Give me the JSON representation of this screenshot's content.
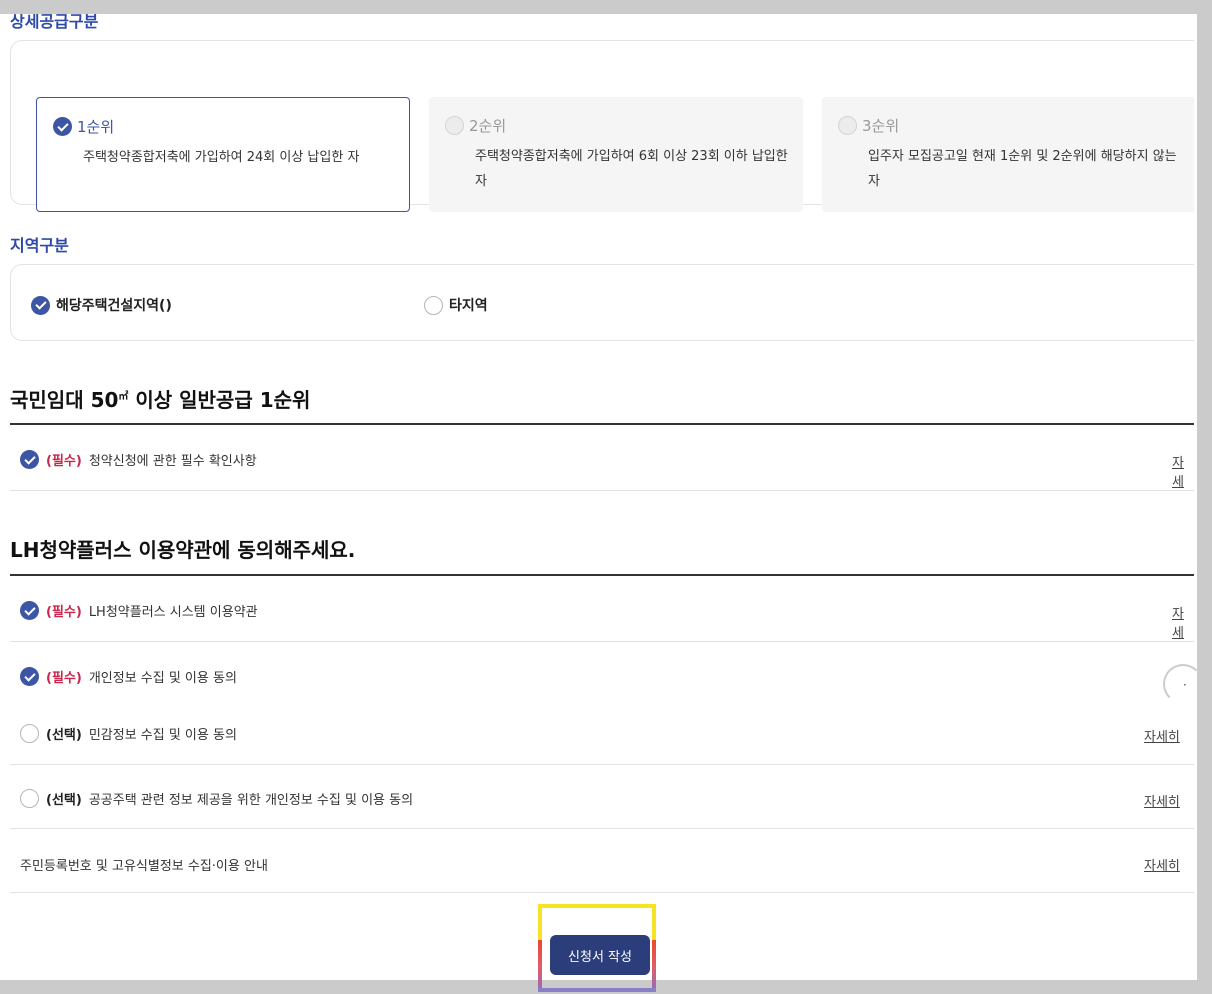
{
  "supply": {
    "heading": "상세공급구분",
    "options": [
      {
        "label": "1순위",
        "desc": "주택청약종합저축에 가입하여 24회 이상 납입한 자",
        "selected": true
      },
      {
        "label": "2순위",
        "desc": "주택청약종합저축에 가입하여 6회 이상 23회 이하 납입한 자",
        "selected": false
      },
      {
        "label": "3순위",
        "desc": "입주자 모집공고일 현재 1순위 및 2순위에 해당하지 않는 자",
        "selected": false
      }
    ]
  },
  "region": {
    "heading": "지역구분",
    "options": [
      {
        "label": "해당주택건설지역()",
        "selected": true
      },
      {
        "label": "타지역",
        "selected": false
      }
    ]
  },
  "rank_section": {
    "title_prefix": "국민임대 50",
    "title_unit": "㎡",
    "title_suffix": " 이상 일반공급 1순위",
    "items": [
      {
        "tag": "(필수)",
        "text": "청약신청에 관한 필수 확인사항",
        "link": "자세"
      }
    ]
  },
  "terms_section": {
    "title": "LH청약플러스 이용약관에 동의해주세요.",
    "items": [
      {
        "tag": "(필수)",
        "text": "LH청약플러스 시스템 이용약관",
        "link": "자세"
      },
      {
        "tag": "(필수)",
        "text": "개인정보 수집 및 이용 동의",
        "link": ""
      },
      {
        "tag": "(선택)",
        "text": "민감정보 수집 및 이용 동의",
        "link": "자세히"
      },
      {
        "tag": "(선택)",
        "text": "공공주택 관련 정보 제공을 위한 개인정보 수집 및 이용 동의",
        "link": "자세히"
      }
    ],
    "notice": {
      "text": "주민등록번호 및 고유식별정보 수집·이용 안내",
      "link": "자세히"
    }
  },
  "cta": {
    "label": "신청서 작성"
  },
  "spinner": {
    "mark": "·"
  },
  "colors": {
    "accent": "#3d55a5",
    "required": "#c8264b",
    "button": "#2b3d7a",
    "highlight": "#f6e325"
  }
}
